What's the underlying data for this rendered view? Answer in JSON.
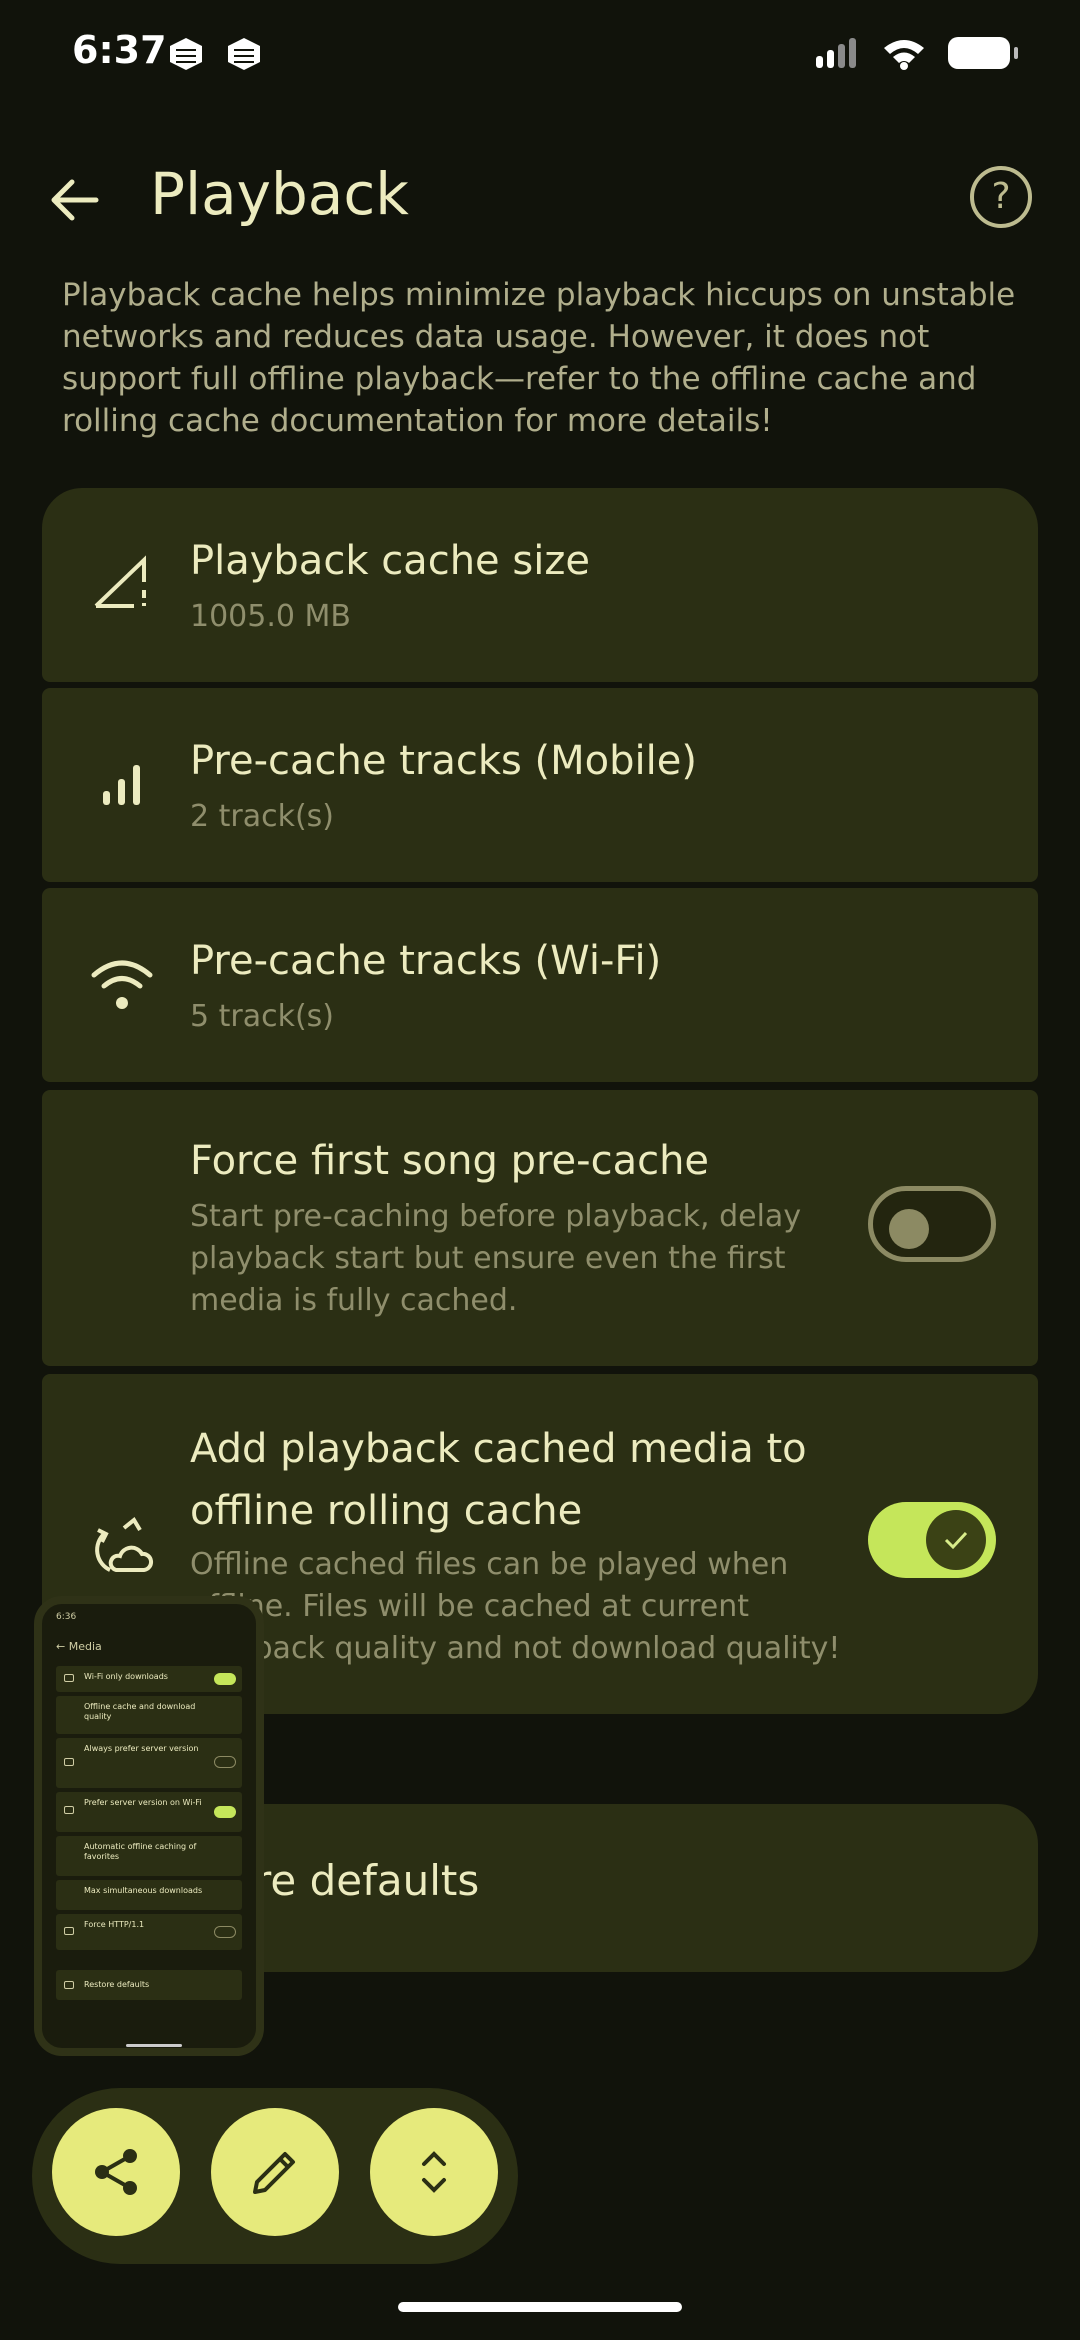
{
  "status": {
    "time": "6:37"
  },
  "header": {
    "title": "Playback",
    "back_icon": "arrow-back-icon",
    "help_icon": "help-icon"
  },
  "description": "Playback cache helps minimize playback hiccups on unstable networks and reduces data usage. However, it does not support full offline playback—refer to the offline cache and rolling cache documentation for more details!",
  "settings": [
    {
      "title": "Playback cache size",
      "subtitle": "1005.0 MB",
      "icon": "storage-icon"
    },
    {
      "title": "Pre-cache tracks (Mobile)",
      "subtitle": "2 track(s)",
      "icon": "cellular-bars-icon"
    },
    {
      "title": "Pre-cache tracks (Wi-Fi)",
      "subtitle": "5 track(s)",
      "icon": "wifi-icon"
    },
    {
      "title": "Force first song pre-cache",
      "subtitle": "Start pre-caching before playback, delay playback start but ensure even the first media is fully cached.",
      "toggle": false
    },
    {
      "title": "Add playback cached media to offline rolling cache",
      "subtitle": "Offline cached files can be played when offline. Files will be cached at current playback quality and not download quality!",
      "icon": "cloud-sync-icon",
      "toggle": true
    }
  ],
  "restore": {
    "label": "store defaults"
  },
  "mini_preview": {
    "time": "6:36",
    "title": "Media",
    "rows": [
      {
        "label": "Wi-Fi only downloads",
        "toggle": true
      },
      {
        "label": "Offline cache and download quality"
      },
      {
        "label": "Always prefer server version",
        "toggle": false
      },
      {
        "label": "Prefer server version on Wi-Fi",
        "toggle": true
      },
      {
        "label": "Automatic offline caching of favorites"
      },
      {
        "label": "Max simultaneous downloads"
      },
      {
        "label": "Force HTTP/1.1",
        "toggle": false
      }
    ],
    "restore": "Restore defaults"
  },
  "fabs": [
    {
      "name": "share-button",
      "icon": "share-icon"
    },
    {
      "name": "edit-button",
      "icon": "pencil-icon"
    },
    {
      "name": "expand-button",
      "icon": "unfold-icon"
    }
  ],
  "colors": {
    "background": "#11130b",
    "card": "#2b2f14",
    "accent": "#c5e65a",
    "fab": "#e6ea7c",
    "text": "#ecebbf"
  }
}
